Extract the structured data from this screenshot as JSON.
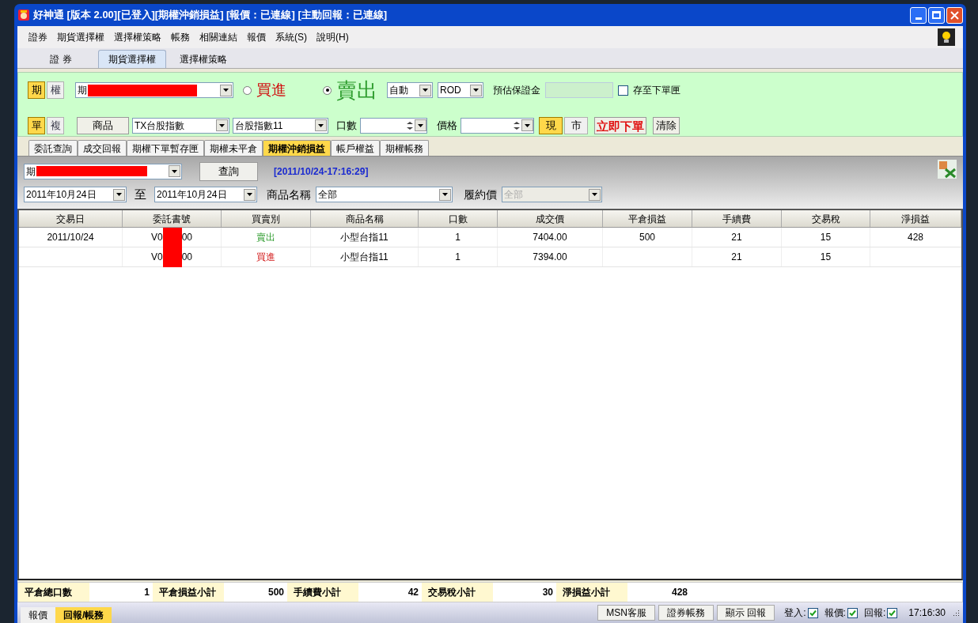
{
  "window": {
    "title": "好神通 [版本 2.00][已登入][期權沖銷損益] [報價：已連線] [主動回報：已連線]"
  },
  "menu": [
    "證券",
    "期貨選擇權",
    "選擇權策略",
    "帳務",
    "相關連結",
    "報價",
    "系統(S)",
    "說明(H)"
  ],
  "main_tabs": [
    {
      "label": "證 券",
      "selected": false
    },
    {
      "label": "期貨選擇權",
      "selected": true
    },
    {
      "label": "選擇權策略",
      "selected": false
    }
  ],
  "order_panel": {
    "type_toggle": [
      {
        "label": "期",
        "selected": true
      },
      {
        "label": "權",
        "selected": false
      }
    ],
    "account": {
      "value": "期"
    },
    "side": [
      {
        "label": "買進",
        "selected": false,
        "kind": "buy"
      },
      {
        "label": "賣出",
        "selected": true,
        "kind": "sell"
      }
    ],
    "condition": {
      "value": "自動"
    },
    "duration": {
      "value": "ROD"
    },
    "margin": {
      "label": "預估保證金"
    },
    "save_to_box": {
      "label": "存至下單匣",
      "checked": false
    },
    "mode_toggle": [
      {
        "label": "單",
        "selected": true
      },
      {
        "label": "複",
        "selected": false
      }
    ],
    "product_button": "商品",
    "product": {
      "value": "TX台股指數"
    },
    "contract": {
      "value": "台股指數11"
    },
    "quantity": {
      "label": "口數"
    },
    "price": {
      "label": "價格"
    },
    "price_type": [
      {
        "label": "現",
        "selected": true
      },
      {
        "label": "市",
        "selected": false
      }
    ],
    "submit": "立即下單",
    "clear": "清除"
  },
  "sub_tabs": [
    {
      "label": "委託查詢",
      "selected": false
    },
    {
      "label": "成交回報",
      "selected": false
    },
    {
      "label": "期權下單暫存匣",
      "selected": false
    },
    {
      "label": "期權未平倉",
      "selected": false
    },
    {
      "label": "期權沖銷損益",
      "selected": true
    },
    {
      "label": "帳戶權益",
      "selected": false
    },
    {
      "label": "期權帳務",
      "selected": false
    }
  ],
  "query": {
    "account": {
      "value": "期"
    },
    "button": "查詢",
    "timestamp": "[2011/10/24-17:16:29]",
    "date_from": "2011年10月24日",
    "to_label": "至",
    "date_to": "2011年10月24日",
    "product_label": "商品名稱",
    "product": "全部",
    "strike_label": "履約價",
    "strike": {
      "value": "全部",
      "disabled": true
    }
  },
  "table": {
    "columns": [
      "交易日",
      "委託書號",
      "買賣別",
      "商品名稱",
      "口數",
      "成交價",
      "平倉損益",
      "手續費",
      "交易稅",
      "淨損益"
    ],
    "rows": [
      {
        "date": "2011/10/24",
        "order_no": [
          "V0",
          "00"
        ],
        "side": {
          "label": "賣出",
          "kind": "sell"
        },
        "product": "小型台指11",
        "qty": "1",
        "price": "7404.00",
        "close_pl": "500",
        "fee": "21",
        "tax": "15",
        "net": "428"
      },
      {
        "date": "",
        "order_no": [
          "V0",
          "00"
        ],
        "side": {
          "label": "買進",
          "kind": "buy"
        },
        "product": "小型台指11",
        "qty": "1",
        "price": "7394.00",
        "close_pl": "",
        "fee": "21",
        "tax": "15",
        "net": ""
      }
    ]
  },
  "summary": [
    {
      "label": "平倉總口數",
      "value": "1"
    },
    {
      "label": "平倉損益小計",
      "value": "500"
    },
    {
      "label": "手續費小計",
      "value": "42"
    },
    {
      "label": "交易稅小計",
      "value": "30"
    },
    {
      "label": "淨損益小計",
      "value": "428"
    }
  ],
  "bottom_tabs": [
    {
      "label": "報價",
      "selected": false
    },
    {
      "label": "回報/帳務",
      "selected": true
    }
  ],
  "status_bar": {
    "buttons": [
      "MSN客服",
      "證券帳務",
      "顯示 回報"
    ],
    "indicators": [
      {
        "label": "登入:",
        "checked": true
      },
      {
        "label": "報價:",
        "checked": true
      },
      {
        "label": "回報:",
        "checked": true
      }
    ],
    "time": "17:16:30"
  }
}
